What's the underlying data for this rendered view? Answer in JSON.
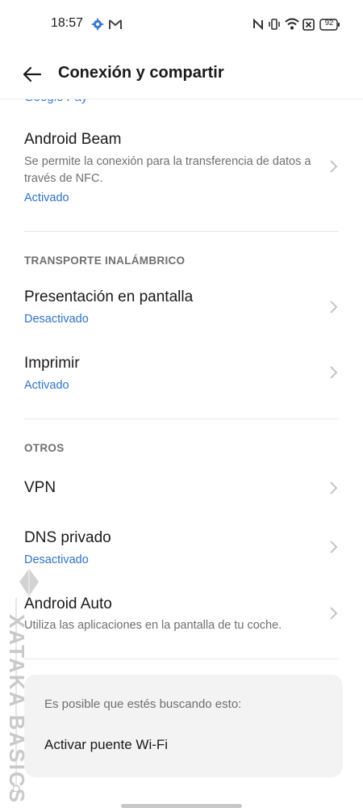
{
  "status_bar": {
    "time": "18:57",
    "battery": "92",
    "icons_left": [
      "settings-gear-icon",
      "gmail-icon"
    ],
    "icons_right": [
      "nfc-icon",
      "vibrate-icon",
      "wifi-icon",
      "sim-off-icon",
      "battery-icon"
    ]
  },
  "app_bar": {
    "title": "Conexión y compartir",
    "back_icon": "arrow-left-icon"
  },
  "cut_off_item": "Google Pay",
  "items": {
    "android_beam": {
      "title": "Android Beam",
      "subtitle": "Se permite la conexión para la transferencia de datos a través de NFC.",
      "status": "Activado"
    },
    "presentacion": {
      "title": "Presentación en pantalla",
      "status": "Desactivado"
    },
    "imprimir": {
      "title": "Imprimir",
      "status": "Activado"
    },
    "vpn": {
      "title": "VPN"
    },
    "dns": {
      "title": "DNS privado",
      "status": "Desactivado"
    },
    "android_auto": {
      "title": "Android Auto",
      "subtitle": "Utiliza las aplicaciones en la pantalla de tu coche."
    }
  },
  "sections": {
    "transporte": "TRANSPORTE INALÁMBRICO",
    "otros": "OTROS"
  },
  "suggestion": {
    "heading": "Es posible que estés buscando esto:",
    "link": "Activar puente Wi-Fi"
  },
  "watermark": "XATAKA BASICS",
  "colors": {
    "accent": "#2f73c7",
    "text": "#1a1a1a",
    "secondary": "#6f6f6f"
  }
}
